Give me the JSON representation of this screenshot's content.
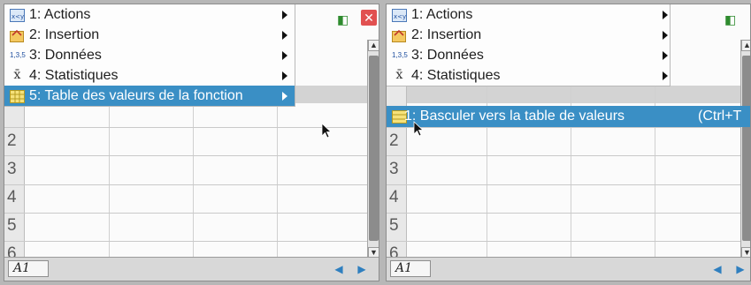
{
  "left_panel": {
    "menu_items": [
      {
        "label": "1: Actions",
        "icon": "actions-icon"
      },
      {
        "label": "2: Insertion",
        "icon": "insertion-icon"
      },
      {
        "label": "3: Données",
        "icon": "data-icon",
        "icon_text": "1,3,5"
      },
      {
        "label": "4: Statistiques",
        "icon": "statistics-icon",
        "icon_text": "x̄"
      },
      {
        "label": "5: Table des valeurs de la fonction",
        "icon": "function-table-icon",
        "selected": true
      }
    ],
    "row_numbers": [
      "2",
      "3",
      "4",
      "5",
      "6"
    ],
    "cell_ref": "A1"
  },
  "right_panel": {
    "menu_items": [
      {
        "label": "1: Actions",
        "icon": "actions-icon"
      },
      {
        "label": "2: Insertion",
        "icon": "insertion-icon"
      },
      {
        "label": "3: Données",
        "icon": "data-icon",
        "icon_text": "1,3,5"
      },
      {
        "label": "4: Statistiques",
        "icon": "statistics-icon",
        "icon_text": "x̄"
      }
    ],
    "submenu_item": {
      "label": "1: Basculer vers la table de valeurs",
      "shortcut": "(Ctrl+T"
    },
    "row_numbers": [
      "2",
      "3",
      "4",
      "5",
      "6"
    ],
    "cell_ref": "A1"
  },
  "colors": {
    "selection": "#3a8fc5",
    "scroll_arrows": "#2f7fbf",
    "close_button": "#e15050"
  }
}
